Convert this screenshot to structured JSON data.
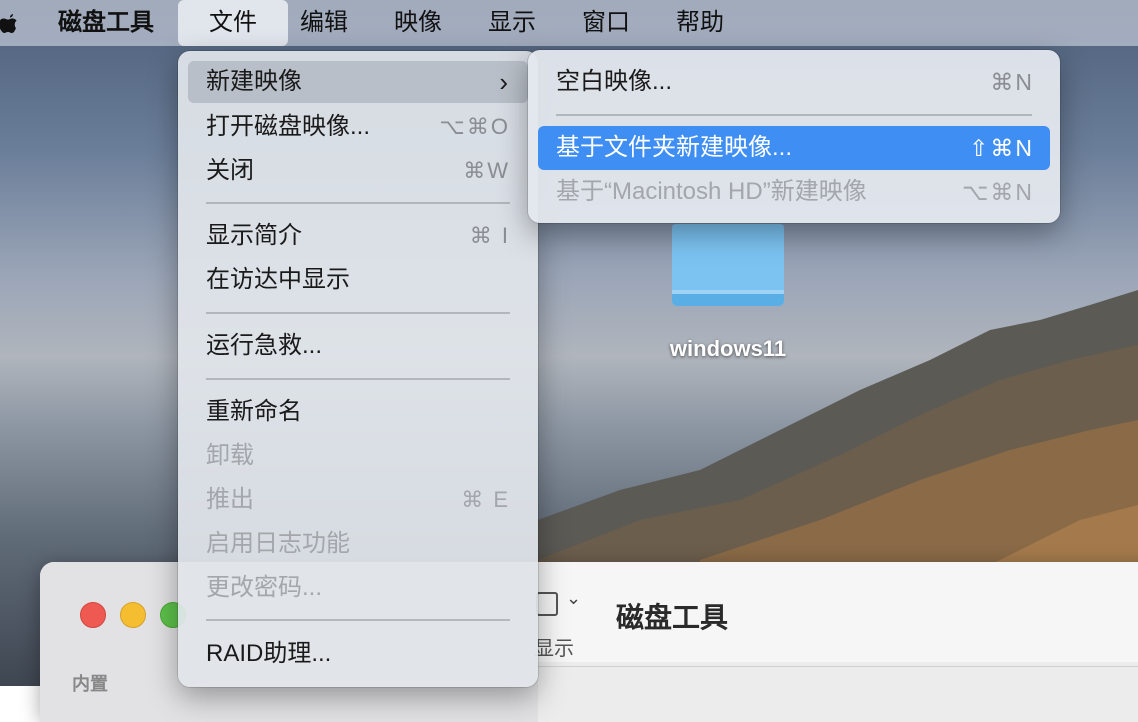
{
  "menubar": {
    "app_name": "磁盘工具",
    "items": [
      "文件",
      "编辑",
      "映像",
      "显示",
      "窗口",
      "帮助"
    ]
  },
  "file_menu": {
    "items": [
      {
        "label": "新建映像",
        "shortcut": "",
        "submenu": true
      },
      {
        "label": "打开磁盘映像...",
        "shortcut": "⌥⌘O"
      },
      {
        "label": "关闭",
        "shortcut": "⌘W"
      },
      {
        "label": "显示简介",
        "shortcut": "⌘ I"
      },
      {
        "label": "在访达中显示",
        "shortcut": ""
      },
      {
        "label": "运行急救...",
        "shortcut": ""
      },
      {
        "label": "重新命名",
        "shortcut": ""
      },
      {
        "label": "卸载",
        "shortcut": "",
        "disabled": true
      },
      {
        "label": "推出",
        "shortcut": "⌘ E",
        "disabled": true
      },
      {
        "label": "启用日志功能",
        "shortcut": "",
        "disabled": true
      },
      {
        "label": "更改密码...",
        "shortcut": "",
        "disabled": true
      },
      {
        "label": "RAID助理...",
        "shortcut": ""
      }
    ]
  },
  "new_image_submenu": {
    "items": [
      {
        "label": "空白映像...",
        "shortcut": "⌘N"
      },
      {
        "label": "基于文件夹新建映像...",
        "shortcut": "⇧⌘N",
        "selected": true
      },
      {
        "label": "基于“Macintosh HD”新建映像",
        "shortcut": "⌥⌘N",
        "disabled": true
      }
    ]
  },
  "desktop": {
    "folder_name": "windows11"
  },
  "window": {
    "title": "磁盘工具",
    "view_label": "显示",
    "sidebar_section": "内置"
  },
  "colors": {
    "selection": "#3f8ef4",
    "folder": "#7cc3f2"
  }
}
